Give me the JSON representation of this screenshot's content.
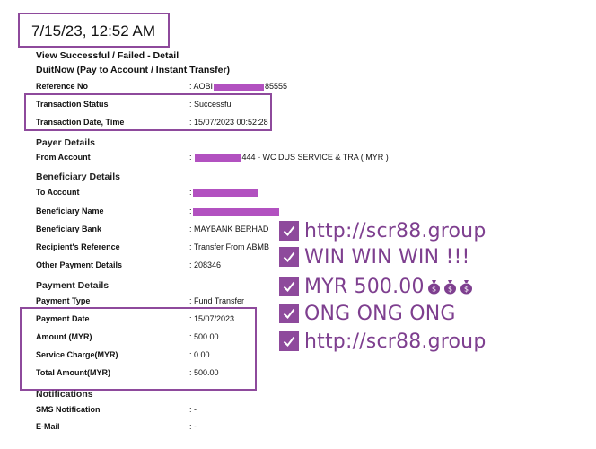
{
  "timestamp": "7/15/23, 12:52 AM",
  "page_title": "View Successful / Failed - Detail",
  "transfer_type": "DuitNow (Pay to Account / Instant Transfer)",
  "reference": {
    "label": "Reference No",
    "prefix": ": AOBI",
    "suffix": "85555"
  },
  "status": {
    "label": "Transaction Status",
    "value": ": Successful"
  },
  "txn_date": {
    "label": "Transaction Date, Time",
    "value": ": 15/07/2023 00:52:28"
  },
  "payer_section": "Payer Details",
  "from_account": {
    "label": "From Account",
    "prefix": ":",
    "suffix": "444 - WC DUS SERVICE & TRA ( MYR )"
  },
  "beneficiary_section": "Beneficiary Details",
  "to_account": {
    "label": "To Account",
    "prefix": ":"
  },
  "beneficiary_name": {
    "label": "Beneficiary Name",
    "prefix": ":"
  },
  "beneficiary_bank": {
    "label": "Beneficiary Bank",
    "value": ": MAYBANK BERHAD"
  },
  "recipient_ref": {
    "label": "Recipient's Reference",
    "value": ": Transfer From ABMB"
  },
  "other_payment": {
    "label": "Other Payment Details",
    "value": ": 208346"
  },
  "payment_section": "Payment Details",
  "payment_type": {
    "label": "Payment Type",
    "value": ": Fund Transfer"
  },
  "payment_date": {
    "label": "Payment Date",
    "value": ": 15/07/2023"
  },
  "amount": {
    "label": "Amount (MYR)",
    "value": ": 500.00"
  },
  "service_charge": {
    "label": "Service Charge(MYR)",
    "value": ": 0.00"
  },
  "total_amount": {
    "label": "Total Amount(MYR)",
    "value": ": 500.00"
  },
  "notifications_section": "Notifications",
  "sms": {
    "label": "SMS Notification",
    "value": ": -"
  },
  "email": {
    "label": "E-Mail",
    "value": ": -"
  },
  "promo": [
    {
      "text": "http://scr88.group",
      "icon": "check-icon"
    },
    {
      "text": "WIN WIN WIN !!!",
      "icon": "check-icon"
    },
    {
      "text": "MYR 500.00",
      "icon": "check-icon",
      "trailing_icons": [
        "money-bag-icon",
        "money-bag-icon",
        "money-bag-icon"
      ]
    },
    {
      "text": "ONG ONG ONG",
      "icon": "check-icon"
    },
    {
      "text": "http://scr88.group",
      "icon": "check-icon"
    }
  ],
  "colors": {
    "accent": "#8e4a9c",
    "redaction": "#b251c0",
    "promo_text": "#7e3f8f"
  }
}
